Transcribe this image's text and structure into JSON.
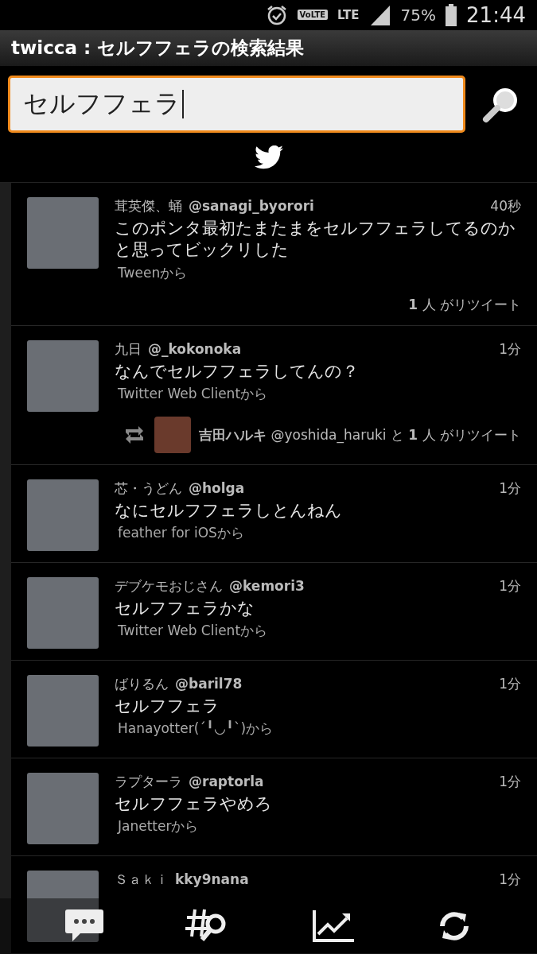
{
  "status_bar": {
    "volte": "VoLTE",
    "network": "LTE",
    "battery": "75%",
    "time": "21:44"
  },
  "title_bar": {
    "title": "twicca : セルフフェラの検索結果"
  },
  "search": {
    "value": "セルフフェラ"
  },
  "tweets": [
    {
      "name": "茸英傑、蛹",
      "handle": "@sanagi_byorori",
      "time": "40秒",
      "text": "このポンタ最初たまたまをセルフフェラしてるのかと思ってビックリした",
      "source": "Tweenから",
      "retweet": {
        "kind": "count",
        "text": "**1** 人 がリツイート"
      }
    },
    {
      "name": "九日",
      "handle": "@_kokonoka",
      "time": "1分",
      "text": "なんでセルフフェラしてんの？",
      "source": "Twitter Web Clientから",
      "retweet": {
        "kind": "user",
        "text": "**吉田ハルキ** @yoshida_haruki と **1** 人 がリツイート"
      }
    },
    {
      "name": "芯・うどん",
      "handle": "@holga",
      "time": "1分",
      "text": "なにセルフフェラしとんねん",
      "source": "feather for iOSから"
    },
    {
      "name": "デブケモおじさん",
      "handle": "@kemori3",
      "time": "1分",
      "text": "セルフフェラかな",
      "source": "Twitter Web Clientから"
    },
    {
      "name": "ばりるん",
      "handle": "@baril78",
      "time": "1分",
      "text": "セルフフェラ",
      "source": "Hanayotter(´╹◡╹`)から"
    },
    {
      "name": "ラプターラ",
      "handle": "@raptorla",
      "time": "1分",
      "text": "セルフフェラやめろ",
      "source": "Janetterから"
    },
    {
      "name": "Ｓａｋｉ",
      "handle": "kky9nana",
      "time": "1分"
    }
  ]
}
